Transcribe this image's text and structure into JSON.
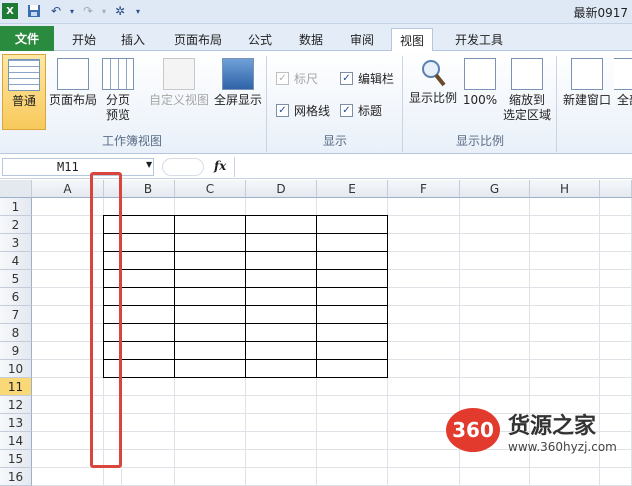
{
  "window": {
    "title": "最新0917"
  },
  "quick_access": {
    "icons": [
      "excel-logo-icon",
      "save-icon",
      "undo-icon",
      "redo-icon",
      "customize-icon"
    ]
  },
  "tabs": [
    "文件",
    "开始",
    "插入",
    "页面布局",
    "公式",
    "数据",
    "审阅",
    "视图",
    "开发工具"
  ],
  "ribbon": {
    "workbook_views": {
      "label": "工作簿视图",
      "normal": "普通",
      "page_layout": "页面布局",
      "page_break": "分页\n预览",
      "custom_views": "自定义视图",
      "full_screen": "全屏显示"
    },
    "show": {
      "label": "显示",
      "ruler": "标尺",
      "formula_bar": "编辑栏",
      "gridlines": "网格线",
      "headings": "标题"
    },
    "zoom": {
      "label": "显示比例",
      "zoom": "显示比例",
      "zoom100": "100%",
      "zoom_selection": "缩放到\n选定区域"
    },
    "window": {
      "new_window": "新建窗口",
      "arrange": "全部"
    }
  },
  "formula_bar": {
    "name_box": "M11",
    "fx": "fx"
  },
  "columns": [
    "A",
    "B",
    "C",
    "D",
    "E",
    "F",
    "G",
    "H"
  ],
  "rows": [
    "1",
    "2",
    "3",
    "4",
    "5",
    "6",
    "7",
    "8",
    "9",
    "10",
    "11",
    "12",
    "13",
    "14",
    "15",
    "16"
  ],
  "selected_row": "11",
  "watermark": {
    "logo": "360",
    "name": "货源之家",
    "url": "www.360hyzj.com"
  }
}
